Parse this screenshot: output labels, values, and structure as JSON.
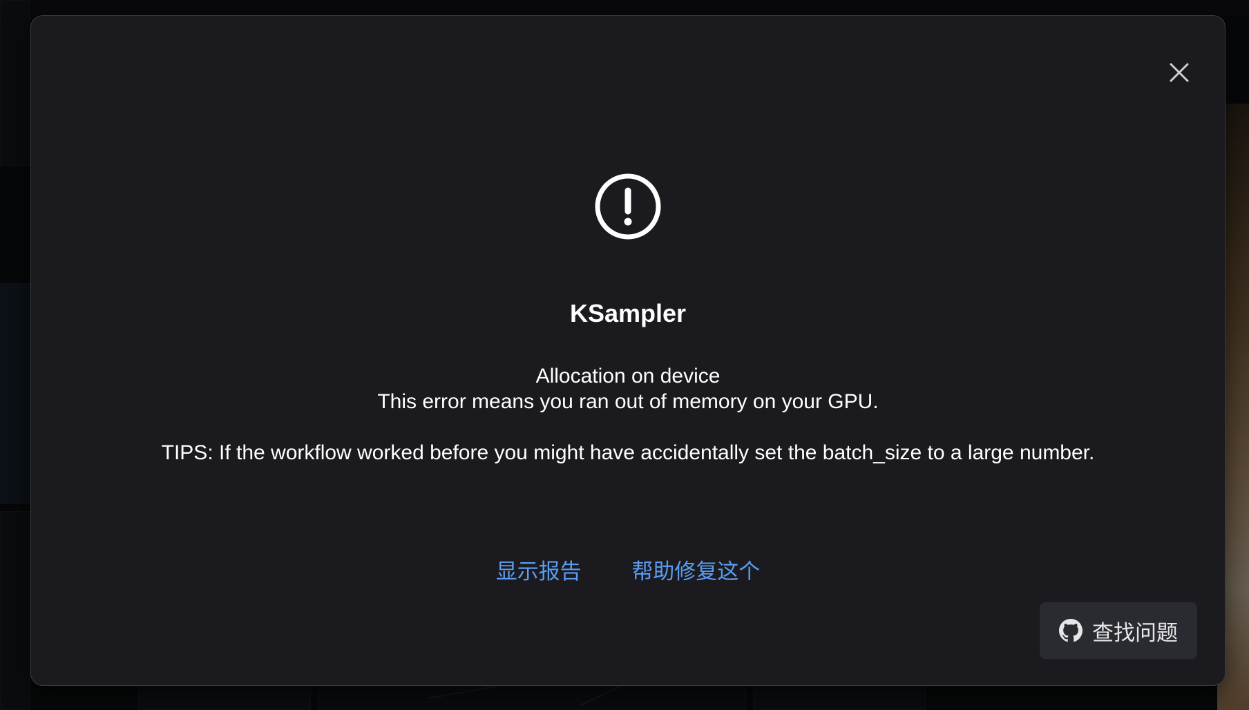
{
  "dialog": {
    "title": "KSampler",
    "message_line1": "Allocation on device",
    "message_line2": "This error means you ran out of memory on your GPU.",
    "tips": "TIPS: If the workflow worked before you might have accidentally set the batch_size to a large number.",
    "close_icon": "close-icon",
    "error_icon": "alert-circle-icon"
  },
  "actions": {
    "show_report": "显示报告",
    "help_fix": "帮助修复这个",
    "find_issues": "查找问题",
    "find_issues_icon": "github-icon"
  },
  "colors": {
    "modal_bg": "#1b1b1f",
    "link": "#5b9cf0",
    "issue_button_bg": "#2a2b31"
  }
}
